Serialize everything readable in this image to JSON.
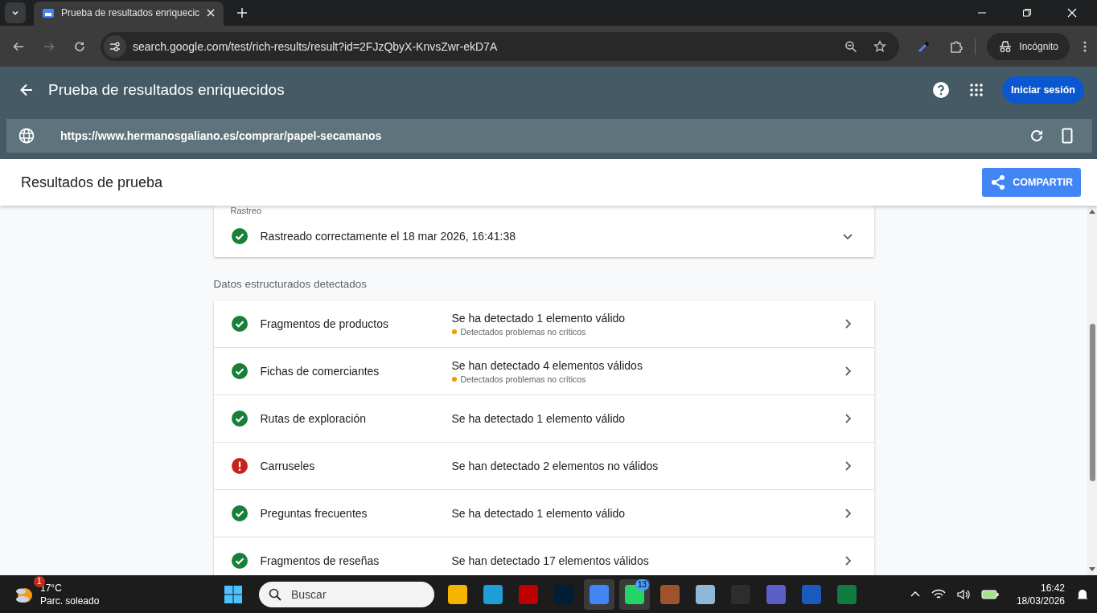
{
  "browser": {
    "tab_title": "Prueba de resultados enriquecic",
    "address": "search.google.com/test/rich-results/result?id=2FJzQbyX-KnvsZwr-ekD7A",
    "profile": "Incógnito"
  },
  "header": {
    "title": "Prueba de resultados enriquecidos",
    "sign_in": "Iniciar sesión",
    "tested_url": "https://www.hermanosgaliano.es/comprar/papel-secamanos"
  },
  "results_bar": {
    "title": "Resultados de prueba",
    "share": "COMPARTIR"
  },
  "crawl": {
    "label": "Rastreo",
    "text": "Rastreado correctamente el 18 mar 2026, 16:41:38",
    "expanded": false
  },
  "detected": {
    "heading": "Datos estructurados detectados",
    "items": [
      {
        "name": "Fragmentos de productos",
        "kind": "valid",
        "summary": "Se ha detectado 1 elemento válido",
        "note": "Detectados problemas no críticos"
      },
      {
        "name": "Fichas de comerciantes",
        "kind": "valid",
        "summary": "Se han detectado 4 elementos válidos",
        "note": "Detectados problemas no críticos"
      },
      {
        "name": "Rutas de exploración",
        "kind": "valid",
        "summary": "Se ha detectado 1 elemento válido"
      },
      {
        "name": "Carruseles",
        "kind": "error",
        "summary": "Se han detectado 2 elementos no válidos"
      },
      {
        "name": "Preguntas frecuentes",
        "kind": "valid",
        "summary": "Se ha detectado 1 elemento válido"
      },
      {
        "name": "Fragmentos de reseñas",
        "kind": "valid",
        "summary": "Se han detectado 17 elementos válidos"
      }
    ]
  },
  "taskbar": {
    "weather": {
      "temp": "17°C",
      "text": "Parc. soleado",
      "badge": "1"
    },
    "search": {
      "placeholder": "Buscar"
    },
    "apps": [
      {
        "color": "#f4b400",
        "active": false
      },
      {
        "color": "#1f9ed8",
        "active": false
      },
      {
        "color": "#bf0000",
        "active": false
      },
      {
        "color": "#001e36",
        "active": false
      },
      {
        "color": "#4285f4",
        "active": true
      },
      {
        "color": "#25d366",
        "active": true,
        "badge": "13"
      },
      {
        "color": "#a0522d",
        "active": false
      },
      {
        "color": "#8fb7d8",
        "active": false
      },
      {
        "color": "#2d2d2d",
        "active": false
      },
      {
        "color": "#5b5fc7",
        "active": false
      },
      {
        "color": "#185abd",
        "active": false
      },
      {
        "color": "#107c41",
        "active": false
      }
    ],
    "time": "16:42",
    "date": "18/03/2026"
  }
}
